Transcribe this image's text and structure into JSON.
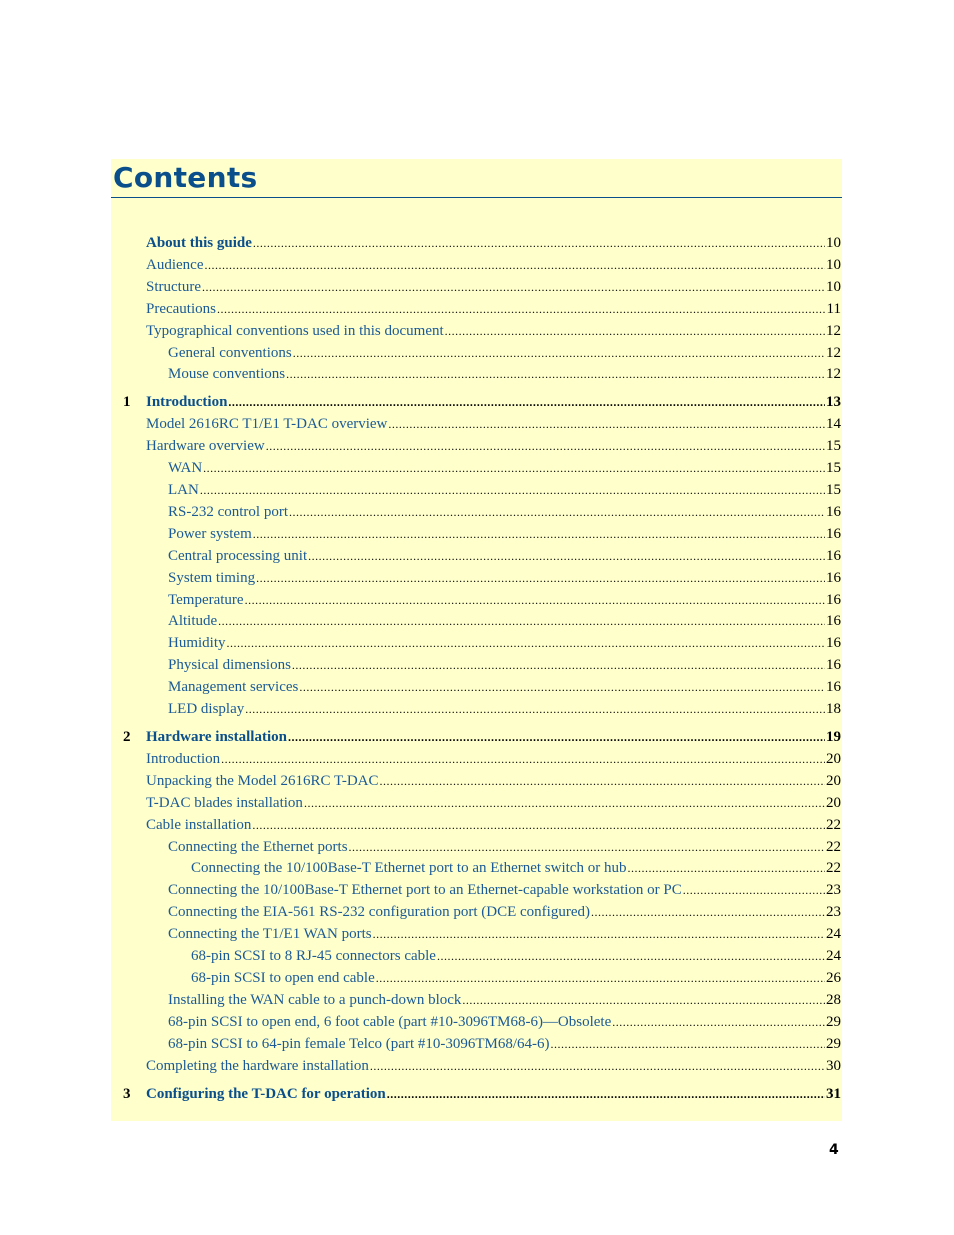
{
  "document": {
    "title": "Contents",
    "page_number": "4"
  },
  "toc": [
    {
      "num": "",
      "label": "About this guide",
      "page": "10",
      "level": 1,
      "style": "bold"
    },
    {
      "num": "",
      "label": "Audience",
      "page": "10",
      "level": 1,
      "style": ""
    },
    {
      "num": "",
      "label": "Structure",
      "page": "10",
      "level": 1,
      "style": ""
    },
    {
      "num": "",
      "label": "Precautions",
      "page": "11",
      "level": 1,
      "style": ""
    },
    {
      "num": "",
      "label": "Typographical conventions used in this document",
      "page": "12",
      "level": 1,
      "style": ""
    },
    {
      "num": "",
      "label": "General conventions",
      "page": "12",
      "level": 2,
      "style": ""
    },
    {
      "num": "",
      "label": "Mouse conventions",
      "page": "12",
      "level": 2,
      "style": ""
    },
    {
      "num": "1",
      "label": "Introduction",
      "page": "13",
      "level": 1,
      "style": "chapter"
    },
    {
      "num": "",
      "label": "Model 2616RC T1/E1 T-DAC overview",
      "page": "14",
      "level": 1,
      "style": ""
    },
    {
      "num": "",
      "label": "Hardware overview",
      "page": "15",
      "level": 1,
      "style": ""
    },
    {
      "num": "",
      "label": "WAN",
      "page": "15",
      "level": 2,
      "style": ""
    },
    {
      "num": "",
      "label": "LAN",
      "page": "15",
      "level": 2,
      "style": ""
    },
    {
      "num": "",
      "label": "RS-232 control port",
      "page": "16",
      "level": 2,
      "style": ""
    },
    {
      "num": "",
      "label": "Power system",
      "page": "16",
      "level": 2,
      "style": ""
    },
    {
      "num": "",
      "label": "Central processing unit",
      "page": "16",
      "level": 2,
      "style": ""
    },
    {
      "num": "",
      "label": "System timing",
      "page": "16",
      "level": 2,
      "style": ""
    },
    {
      "num": "",
      "label": "Temperature",
      "page": "16",
      "level": 2,
      "style": ""
    },
    {
      "num": "",
      "label": "Altitude",
      "page": "16",
      "level": 2,
      "style": ""
    },
    {
      "num": "",
      "label": "Humidity",
      "page": "16",
      "level": 2,
      "style": ""
    },
    {
      "num": "",
      "label": "Physical dimensions",
      "page": "16",
      "level": 2,
      "style": ""
    },
    {
      "num": "",
      "label": "Management services",
      "page": "16",
      "level": 2,
      "style": ""
    },
    {
      "num": "",
      "label": "LED display",
      "page": "18",
      "level": 2,
      "style": ""
    },
    {
      "num": "2",
      "label": "Hardware installation",
      "page": "19",
      "level": 1,
      "style": "chapter"
    },
    {
      "num": "",
      "label": "Introduction",
      "page": "20",
      "level": 1,
      "style": ""
    },
    {
      "num": "",
      "label": "Unpacking the Model 2616RC T-DAC",
      "page": "20",
      "level": 1,
      "style": ""
    },
    {
      "num": "",
      "label": "T-DAC blades installation",
      "page": "20",
      "level": 1,
      "style": ""
    },
    {
      "num": "",
      "label": "Cable installation",
      "page": "22",
      "level": 1,
      "style": ""
    },
    {
      "num": "",
      "label": "Connecting the Ethernet ports",
      "page": "22",
      "level": 2,
      "style": ""
    },
    {
      "num": "",
      "label": "Connecting the 10/100Base-T Ethernet port to an Ethernet switch or hub",
      "page": "22",
      "level": 3,
      "style": ""
    },
    {
      "num": "",
      "label": "Connecting the 10/100Base-T Ethernet port to an Ethernet-capable workstation or PC",
      "page": "23",
      "level": 2,
      "style": ""
    },
    {
      "num": "",
      "label": "Connecting the EIA-561 RS-232 configuration port (DCE configured)",
      "page": "23",
      "level": 2,
      "style": ""
    },
    {
      "num": "",
      "label": "Connecting the T1/E1 WAN ports",
      "page": "24",
      "level": 2,
      "style": ""
    },
    {
      "num": "",
      "label": "68-pin SCSI to 8 RJ-45 connectors cable",
      "page": "24",
      "level": 3,
      "style": ""
    },
    {
      "num": "",
      "label": "68-pin SCSI to open end cable",
      "page": "26",
      "level": 3,
      "style": ""
    },
    {
      "num": "",
      "label": "Installing the WAN cable to a punch-down block",
      "page": "28",
      "level": 2,
      "style": ""
    },
    {
      "num": "",
      "label": "68-pin SCSI to open end, 6 foot cable (part #10-3096TM68-6)—Obsolete",
      "page": "29",
      "level": 2,
      "style": ""
    },
    {
      "num": "",
      "label": "68-pin SCSI to 64-pin female Telco (part #10-3096TM68/64-6)",
      "page": "29",
      "level": 2,
      "style": ""
    },
    {
      "num": "",
      "label": "Completing the hardware installation",
      "page": "30",
      "level": 1,
      "style": ""
    },
    {
      "num": "3",
      "label": "Configuring the T-DAC for operation",
      "page": "31",
      "level": 1,
      "style": "chapter"
    }
  ]
}
